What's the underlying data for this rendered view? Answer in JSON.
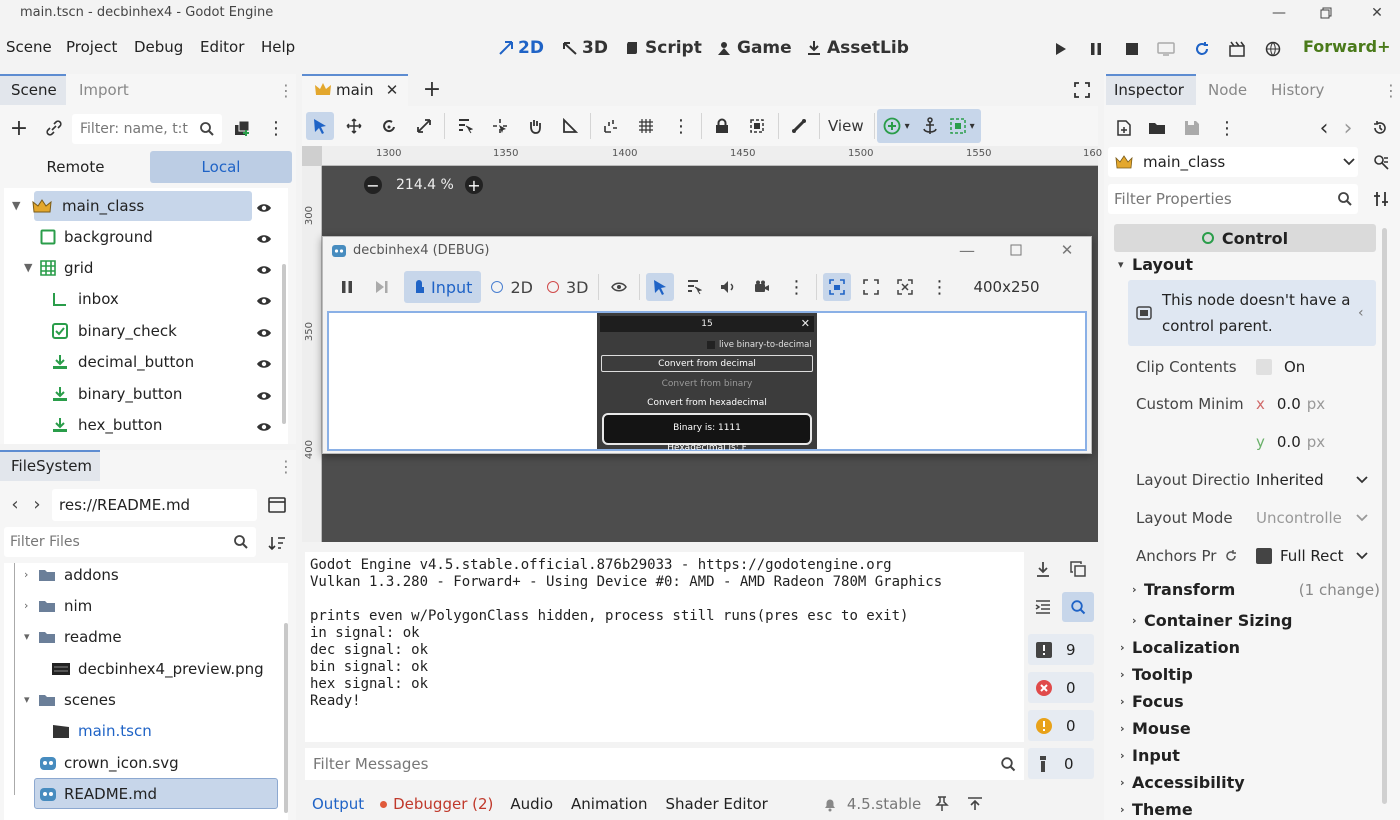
{
  "window": {
    "title": "main.tscn - decbinhex4 - Godot Engine"
  },
  "menu": [
    "Scene",
    "Project",
    "Debug",
    "Editor",
    "Help"
  ],
  "workspaces": [
    {
      "label": "2D",
      "active": true
    },
    {
      "label": "3D",
      "active": false
    },
    {
      "label": "Script",
      "active": false
    },
    {
      "label": "Game",
      "active": false
    },
    {
      "label": "AssetLib",
      "active": false
    }
  ],
  "renderer": "Forward+",
  "scene_dock": {
    "tab_scene": "Scene",
    "tab_import": "Import",
    "filter_placeholder": "Filter: name, t:t",
    "remote": "Remote",
    "local": "Local",
    "nodes": [
      "main_class",
      "background",
      "grid",
      "inbox",
      "binary_check",
      "decimal_button",
      "binary_button",
      "hex_button"
    ]
  },
  "filesystem": {
    "tab": "FileSystem",
    "path": "res://README.md",
    "filter_placeholder": "Filter Files",
    "items": [
      "addons",
      "nim",
      "readme",
      "decbinhex4_preview.png",
      "scenes",
      "main.tscn",
      "crown_icon.svg",
      "README.md"
    ]
  },
  "editor": {
    "tab": "main",
    "view": "View",
    "zoom": "214.4 %",
    "ruler_x": [
      "1300",
      "1350",
      "1400",
      "1450",
      "1500",
      "1550",
      "160"
    ],
    "ruler_y": [
      "300",
      "350",
      "400"
    ]
  },
  "debug_window": {
    "title": "decbinhex4 (DEBUG)",
    "input": "Input",
    "d2": "2D",
    "d3": "3D",
    "size": "400x250",
    "app": {
      "title": "15",
      "check": "live binary-to-decimal",
      "b1": "Convert from decimal",
      "b2": "Convert from binary",
      "b3": "Convert from hexadecimal",
      "out1": "Binary is: 1111",
      "out2": "Hexadecimal is: F"
    }
  },
  "output": {
    "lines": [
      "Godot Engine v4.5.stable.official.876b29033 - https://godotengine.org",
      "Vulkan 1.3.280 - Forward+ - Using Device #0: AMD - AMD Radeon 780M Graphics",
      "",
      "prints even w/PolygonClass hidden, process still runs(pres esc to exit)",
      "in signal: ok",
      "dec signal: ok",
      "bin signal: ok",
      "hex signal: ok",
      "Ready!"
    ],
    "filter_placeholder": "Filter Messages",
    "counts": [
      "9",
      "0",
      "0",
      "0"
    ]
  },
  "bottom_tabs": {
    "output": "Output",
    "debugger": "Debugger (2)",
    "audio": "Audio",
    "animation": "Animation",
    "shader": "Shader Editor",
    "version": "4.5.stable"
  },
  "inspector": {
    "tab_inspector": "Inspector",
    "tab_node": "Node",
    "tab_history": "History",
    "object": "main_class",
    "filter_placeholder": "Filter Properties",
    "class": "Control",
    "layout": "Layout",
    "warning": "This node doesn't have a control parent.",
    "clip": "Clip Contents",
    "on": "On",
    "custom_min": "Custom Minim",
    "x": "x",
    "y": "y",
    "val": "0.0",
    "px": "px",
    "layout_dir": "Layout Directio",
    "inherited": "Inherited",
    "layout_mode": "Layout Mode",
    "uncontrolled": "Uncontrolle",
    "anchors": "Anchors Pr",
    "full_rect": "Full Rect",
    "transform": "Transform",
    "one_change": "(1 change)",
    "container": "Container Sizing",
    "sections": [
      "Localization",
      "Tooltip",
      "Focus",
      "Mouse",
      "Input",
      "Accessibility",
      "Theme"
    ]
  }
}
